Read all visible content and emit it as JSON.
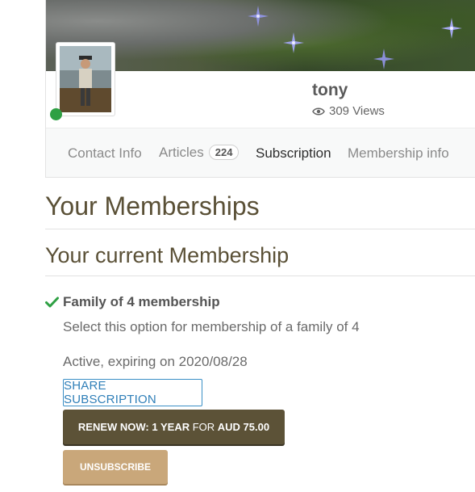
{
  "profile": {
    "name": "tony",
    "views": "309 Views",
    "online_color": "#2ea043"
  },
  "tabs": [
    {
      "label": "Contact Info",
      "active": false
    },
    {
      "label": "Articles",
      "count": "224",
      "active": false
    },
    {
      "label": "Subscription",
      "active": true
    },
    {
      "label": "Membership info",
      "active": false
    }
  ],
  "memberships": {
    "title": "Your Memberships",
    "current_title": "Your current Membership",
    "plan_name": "Family of 4 membership",
    "plan_description": "Select this option for membership of a family of 4",
    "status": "Active, expiring on 2020/08/28",
    "share_label": "SHARE SUBSCRIPTION",
    "renew_prefix": "RENEW NOW: ",
    "renew_term": "1 YEAR",
    "renew_for": " FOR ",
    "renew_price": "AUD 75.00",
    "unsubscribe_label": "UNSUBSCRIBE"
  },
  "colors": {
    "heading": "#5a5036",
    "share_button": "#3a8fc6",
    "renew_button": "#5c5237",
    "unsubscribe_button": "#c9a77a",
    "check": "#2ea043"
  },
  "icons": [
    "eye-icon",
    "check-icon",
    "flower-icon"
  ]
}
